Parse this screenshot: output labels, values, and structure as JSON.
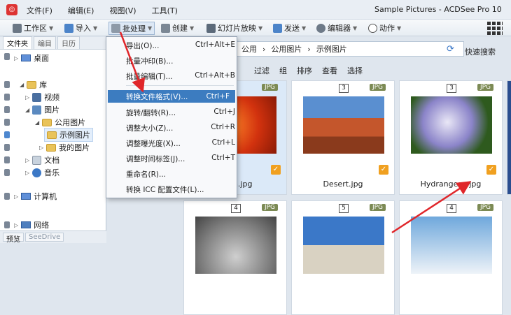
{
  "titlebar": {
    "menus": [
      "文件(F)",
      "编辑(E)",
      "视图(V)",
      "工具(T)"
    ],
    "window_title": "Sample Pictures - ACDSee Pro 10"
  },
  "toolbar": {
    "workspace": "工作区",
    "import": "导入",
    "batch": "批处理",
    "create": "创建",
    "slideshow": "幻灯片放映",
    "send": "发送",
    "editor": "编辑器",
    "action": "动作"
  },
  "left_panel": {
    "tabs": [
      "文件夹",
      "编目",
      "日历"
    ],
    "tree": {
      "desktop": "桌面",
      "library": "库",
      "video": "视频",
      "pictures": "图片",
      "public_pictures": "公用图片",
      "sample_pictures": "示例图片",
      "my_pictures": "我的图片",
      "documents": "文档",
      "music": "音乐",
      "computer": "计算机",
      "network": "网络"
    },
    "bottom_tabs": [
      "预览",
      "SeeDrive"
    ]
  },
  "path": {
    "crumbs": [
      "公用",
      "公用图片",
      "示例图片"
    ],
    "quick_search": "快速搜索"
  },
  "filterbar": [
    "过滤",
    "组",
    "排序",
    "查看",
    "选择"
  ],
  "thumbnails": [
    {
      "name": "Chrysanthemum.jpg",
      "visible_name": "mum.jpg",
      "type": "JPG",
      "rating": "",
      "checked": true
    },
    {
      "name": "Desert.jpg",
      "type": "JPG",
      "rating": "3",
      "checked": true
    },
    {
      "name": "Hydrangeas.jpg",
      "type": "JPG",
      "rating": "3",
      "checked": true
    },
    {
      "name": "",
      "type": "JPG",
      "rating": "4",
      "checked": false
    },
    {
      "name": "",
      "type": "JPG",
      "rating": "5",
      "checked": false
    },
    {
      "name": "",
      "type": "JPG",
      "rating": "4",
      "checked": false
    }
  ],
  "batch_menu": {
    "items": [
      {
        "label": "导出(O)...",
        "shortcut": "Ctrl+Alt+E"
      },
      {
        "label": "批量冲印(B)...",
        "shortcut": ""
      },
      {
        "label": "批量编辑(T)...",
        "shortcut": "Ctrl+Alt+B"
      },
      {
        "label": "转换文件格式(V)...",
        "shortcut": "Ctrl+F"
      },
      {
        "label": "旋转/翻转(R)...",
        "shortcut": "Ctrl+J"
      },
      {
        "label": "调整大小(Z)...",
        "shortcut": "Ctrl+R"
      },
      {
        "label": "调整曝光度(X)...",
        "shortcut": "Ctrl+L"
      },
      {
        "label": "调整时间标签(J)...",
        "shortcut": "Ctrl+T"
      },
      {
        "label": "重命名(R)...",
        "shortcut": ""
      },
      {
        "label": "转换 ICC 配置文件(L)...",
        "shortcut": ""
      }
    ]
  },
  "colors": {
    "highlight": "#3c7cc0",
    "annotation_arrow": "#e0262a",
    "check": "#f0a020"
  }
}
